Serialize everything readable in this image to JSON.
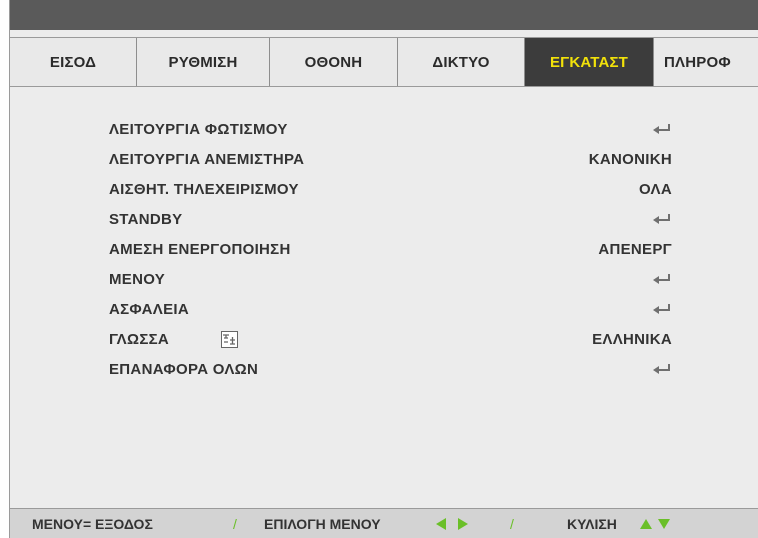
{
  "tabs": [
    {
      "label": "ΕΙΣΟΔ",
      "active": false
    },
    {
      "label": "ΡΥΘΜΙΣΗ",
      "active": false
    },
    {
      "label": "ΟΘΟΝΗ",
      "active": false
    },
    {
      "label": "ΔΙΚΤΥΟ",
      "active": false
    },
    {
      "label": "ΕΓΚΑΤΑΣΤ",
      "active": true
    },
    {
      "label": "ΠΛΗΡΟΦ",
      "active": false
    }
  ],
  "menu": {
    "items": [
      {
        "label": "ΛΕΙΤΟΥΡΓΙΑ ΦΩΤΙΣΜΟΥ",
        "value": "",
        "icon": "enter-icon"
      },
      {
        "label": "ΛΕΙΤΟΥΡΓΙΑ ΑΝΕΜΙΣΤΗΡΑ",
        "value": "ΚΑΝΟΝΙΚΗ"
      },
      {
        "label": "ΑΙΣΘΗΤ. ΤΗΛΕΧΕΙΡΙΣΜΟΥ",
        "value": "ΟΛΑ"
      },
      {
        "label": "STANDBY",
        "value": "",
        "icon": "enter-icon"
      },
      {
        "label": "ΑΜΕΣΗ ΕΝΕΡΓΟΠΟΙΗΣΗ",
        "value": "ΑΠΕΝΕΡΓ"
      },
      {
        "label": "ΜΕΝΟΥ",
        "value": "",
        "icon": "enter-icon"
      },
      {
        "label": "ΑΣΦΑΛΕΙΑ",
        "value": "",
        "icon": "enter-icon"
      },
      {
        "label": "ΓΛΩΣΣΑ",
        "value": "ΕΛΛΗΝΙΚΑ",
        "extra_icon": "language-icon"
      },
      {
        "label": "ΕΠΑΝΑΦΟΡΑ ΟΛΩΝ",
        "value": "",
        "icon": "enter-icon"
      }
    ]
  },
  "footer": {
    "menu_exit": "ΜΕΝΟΥ= ΕΞΟΔΟΣ",
    "separator": "/",
    "menu_select": "ΕΠΙΛΟΓΗ ΜΕΝΟΥ",
    "scroll": "ΚΥΛΙΣΗ",
    "arrow_color": "#6abf28"
  },
  "colors": {
    "active_tab_bg": "#3c3c3c",
    "active_tab_text": "#f2e20a",
    "text": "#333333",
    "panel_bg": "#ececec"
  }
}
